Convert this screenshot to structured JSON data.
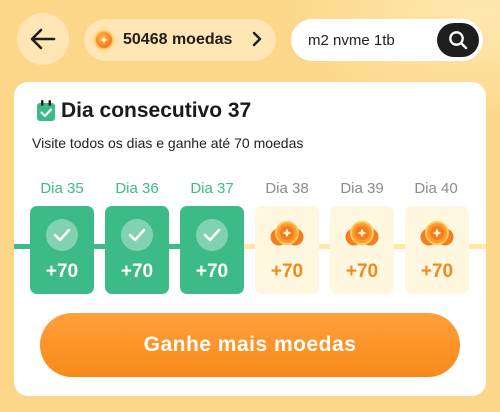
{
  "header": {
    "coin_balance": "50468 moedas",
    "search_value": "m2 nvme 1tb"
  },
  "checkin": {
    "title": "Dia consecutivo 37",
    "subtitle": "Visite todos os dias e ganhe até 70 moedas",
    "days": [
      {
        "label": "Dia 35",
        "reward": "+70",
        "claimed": true
      },
      {
        "label": "Dia 36",
        "reward": "+70",
        "claimed": true
      },
      {
        "label": "Dia 37",
        "reward": "+70",
        "claimed": true
      },
      {
        "label": "Dia 38",
        "reward": "+70",
        "claimed": false
      },
      {
        "label": "Dia 39",
        "reward": "+70",
        "claimed": false
      },
      {
        "label": "Dia 40",
        "reward": "+70",
        "claimed": false
      }
    ],
    "earn_button_label": "Ganhe mais moedas"
  },
  "colors": {
    "accent_green": "#3DBB86",
    "accent_orange": "#F98A1A",
    "background": "#FCD78A"
  },
  "icons": {
    "back": "arrow-left-icon",
    "coin": "coin-icon",
    "chevron": "chevron-right-icon",
    "search": "search-icon",
    "calendar": "calendar-check-icon",
    "check": "check-icon",
    "coin_stack": "coin-stack-icon"
  }
}
